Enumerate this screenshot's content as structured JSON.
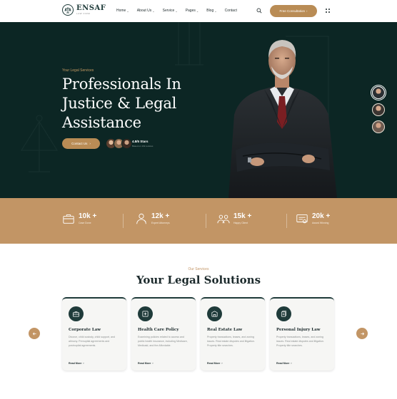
{
  "header": {
    "logo_name": "ENSAF",
    "logo_sub": "LAW FIRM",
    "nav": [
      {
        "label": "Home",
        "dropdown": true
      },
      {
        "label": "About Us",
        "dropdown": true
      },
      {
        "label": "Service",
        "dropdown": true
      },
      {
        "label": "Pages",
        "dropdown": true
      },
      {
        "label": "Blog",
        "dropdown": true
      },
      {
        "label": "Contact",
        "dropdown": false
      }
    ],
    "consult_button": "Free Consultation",
    "arrow_glyph": "›"
  },
  "hero": {
    "eyebrow": "Your Legal Services",
    "title_lines": [
      "Professionals In",
      "Justice & Legal",
      "Assistance"
    ],
    "contact_button": "Contact Us",
    "rating_value": "4.8/5 Stars",
    "rating_sub": "Based on 10k reviews"
  },
  "stats": [
    {
      "value": "10k +",
      "label": "Case Done",
      "icon": "briefcase-icon"
    },
    {
      "value": "12k +",
      "label": "Expert Attorneys",
      "icon": "attorney-icon"
    },
    {
      "value": "15k +",
      "label": "Happy Client",
      "icon": "clients-icon"
    },
    {
      "value": "20k +",
      "label": "Award Winning",
      "icon": "award-icon"
    }
  ],
  "services": {
    "eyebrow": "Our Services",
    "title": "Your Legal Solutions",
    "cards": [
      {
        "title": "Corporate Law",
        "desc": "Divorce, child custody, child support, and alimony. Prenuptial agreements and postnuptial agreements.",
        "link": "Read More",
        "icon": "briefcase-icon"
      },
      {
        "title": "Health Care Policy",
        "desc": "Examining policies related to access and public health insurance, including Medicare, Medicaid, and the Affordable.",
        "link": "Read More",
        "icon": "healthcare-icon"
      },
      {
        "title": "Real Estate Law",
        "desc": "Property transactions, leases, and zoning issues. Real estate disputes and litigation. Property title searches.",
        "link": "Read More",
        "icon": "building-icon"
      },
      {
        "title": "Personal Injury Law",
        "desc": "Property transactions, leases, and zoning issues. Real estate disputes and litigation. Property title searches.",
        "link": "Read More",
        "icon": "documents-icon"
      }
    ]
  },
  "colors": {
    "dark_green": "#0c2624",
    "gold": "#c29565",
    "button_gold": "#b98c55"
  }
}
